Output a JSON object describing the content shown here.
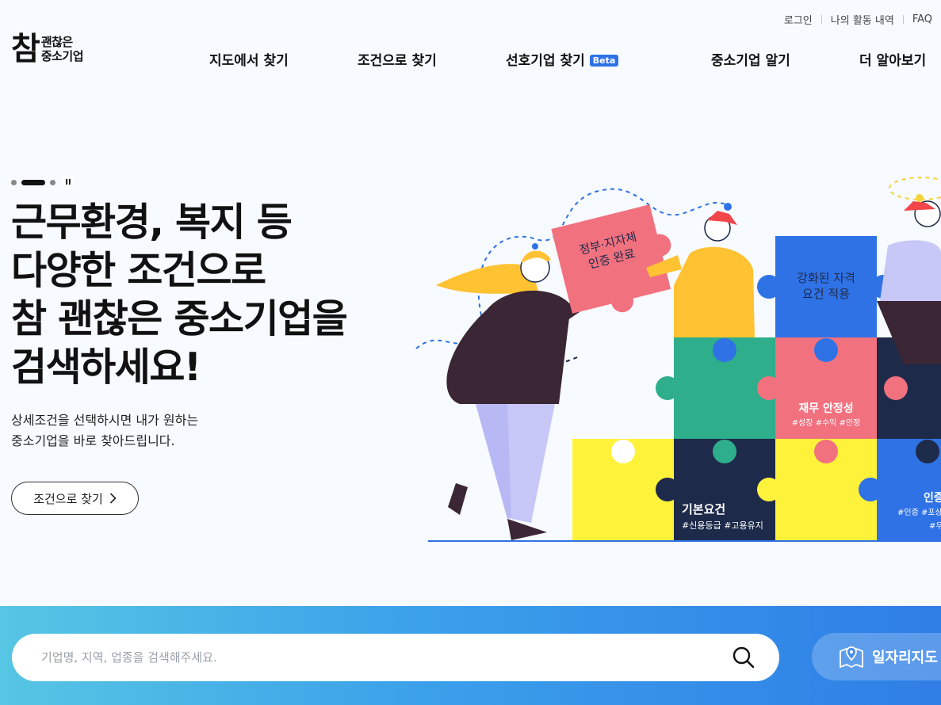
{
  "util_links": {
    "login": "로그인",
    "activity": "나의 활동 내역",
    "faq": "FAQ"
  },
  "logo": {
    "big": "참",
    "line1": "괜찮은",
    "line2": "중소기업"
  },
  "nav": {
    "map_search": "지도에서 찾기",
    "condition_search": "조건으로 찾기",
    "preferred": "선호기업 찾기",
    "beta": "Beta",
    "learn_sme": "중소기업 알기",
    "more": "더 알아보기"
  },
  "hero": {
    "headline": [
      "근무환경, 복지 등",
      "다양한 조건으로",
      "참 괜찮은 중소기업을",
      "검색하세요!"
    ],
    "sub": [
      "상세조건을 선택하시면 내가 원하는",
      "중소기업을 바로 찾아드립니다."
    ],
    "cta_label": "조건으로 찾기",
    "pause_label": "II"
  },
  "illustration": {
    "held_piece": [
      "정부·지자체",
      "인증 완료"
    ],
    "top_blue": [
      "강화된 자격",
      "요건 적용"
    ],
    "finance_title": "재무 안정성",
    "finance_tags": "#성장 #수익 #안정",
    "basic_title": "기본요건",
    "basic_tags": "#신용등급 #고용유지",
    "cert_title": "인증",
    "cert_tags": "#인증 #포상",
    "cert_tags2": "#우"
  },
  "search": {
    "placeholder": "기업명, 지역, 업종을 검색해주세요.",
    "map_button": "일자리지도"
  },
  "colors": {
    "brand_blue": "#2f72e6",
    "pink": "#f2717f",
    "teal": "#2eae8a",
    "navy": "#1e2a4a",
    "yellow": "#fff23a"
  }
}
